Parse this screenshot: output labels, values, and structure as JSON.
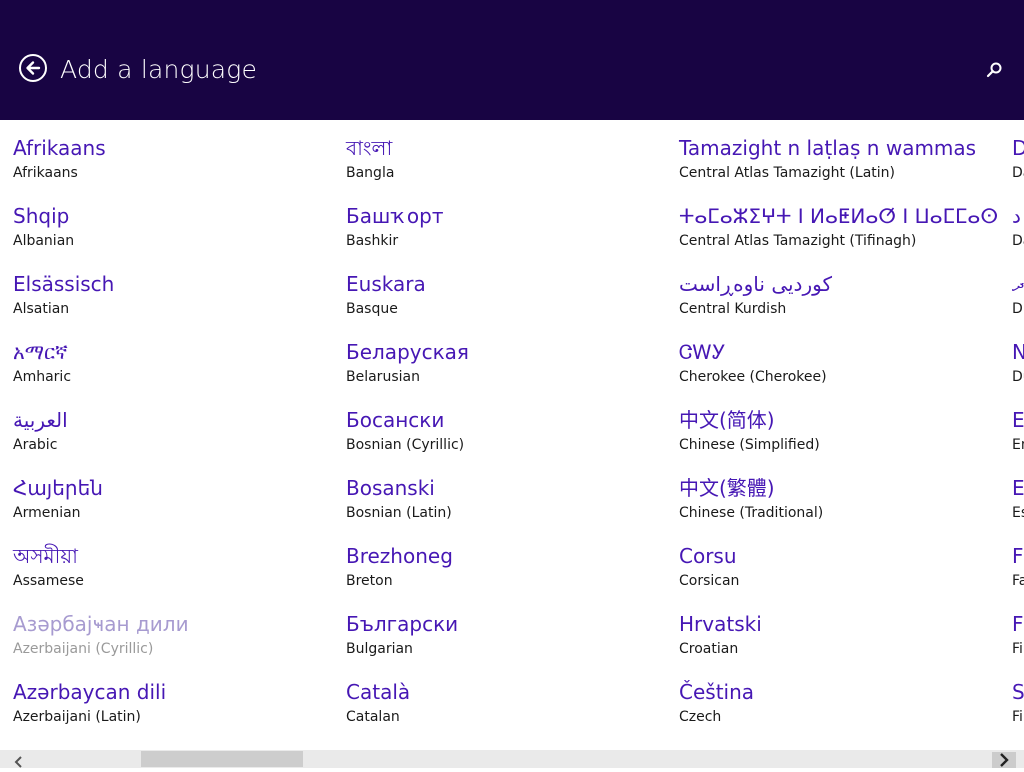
{
  "header": {
    "title": "Add a language",
    "back_icon": "back-arrow-icon",
    "search_icon": "search-icon",
    "bg_color": "#180443"
  },
  "languages": [
    {
      "native": "Afrikaans",
      "english": "Afrikaans"
    },
    {
      "native": "Shqip",
      "english": "Albanian"
    },
    {
      "native": "Elsässisch",
      "english": "Alsatian"
    },
    {
      "native": "አማርኛ",
      "english": "Amharic"
    },
    {
      "native": "العربية",
      "english": "Arabic"
    },
    {
      "native": "Հայերեն",
      "english": "Armenian"
    },
    {
      "native": "অসমীয়া",
      "english": "Assamese"
    },
    {
      "native": "Азәрбајҹан дили",
      "english": "Azerbaijani (Cyrillic)",
      "disabled": true
    },
    {
      "native": "Azərbaycan dili",
      "english": "Azerbaijani (Latin)"
    },
    {
      "native": "বাংলা",
      "english": "Bangla"
    },
    {
      "native": "Башҡорт",
      "english": "Bashkir"
    },
    {
      "native": "Euskara",
      "english": "Basque"
    },
    {
      "native": "Беларуская",
      "english": "Belarusian"
    },
    {
      "native": "Босански",
      "english": "Bosnian (Cyrillic)"
    },
    {
      "native": "Bosanski",
      "english": "Bosnian (Latin)"
    },
    {
      "native": "Brezhoneg",
      "english": "Breton"
    },
    {
      "native": "Български",
      "english": "Bulgarian"
    },
    {
      "native": "Català",
      "english": "Catalan"
    },
    {
      "native": "Tamazight n laṭlaṣ n wammas",
      "english": "Central Atlas Tamazight (Latin)"
    },
    {
      "native": "ⵜⴰⵎⴰⵣⵉⵖⵜ ⵏ ⵍⴰⵟⵍⴰⵚ ⵏ ⵡⴰⵎⵎⴰⵙ",
      "english": "Central Atlas Tamazight (Tifinagh)"
    },
    {
      "native": "کوردیی ناوەڕاست",
      "english": "Central Kurdish"
    },
    {
      "native": "ᏣᎳᎩ",
      "english": "Cherokee (Cherokee)"
    },
    {
      "native": "中文(简体)",
      "english": "Chinese (Simplified)"
    },
    {
      "native": "中文(繁體)",
      "english": "Chinese (Traditional)"
    },
    {
      "native": "Corsu",
      "english": "Corsican"
    },
    {
      "native": "Hrvatski",
      "english": "Croatian"
    },
    {
      "native": "Čeština",
      "english": "Czech"
    },
    {
      "native": "D",
      "english": "Da"
    },
    {
      "native": "د",
      "english": "Da"
    },
    {
      "native": "ދ",
      "english": "Di"
    },
    {
      "native": "N",
      "english": "Du"
    },
    {
      "native": "E",
      "english": "En"
    },
    {
      "native": "E",
      "english": "Es"
    },
    {
      "native": "F",
      "english": "Fa"
    },
    {
      "native": "F",
      "english": "Fil"
    },
    {
      "native": "S",
      "english": "Fin"
    }
  ],
  "scrollbar": {
    "left_icon": "chevron-left-icon",
    "right_icon": "chevron-right-icon",
    "position": 0.14
  }
}
